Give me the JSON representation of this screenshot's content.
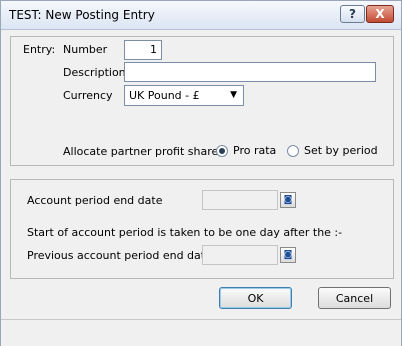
{
  "window": {
    "title": "TEST: New Posting Entry",
    "help_label": "?",
    "close_label": "X"
  },
  "entry": {
    "entry_label": "Entry:",
    "number_label": "Number",
    "number_value": "1",
    "description_label": "Description",
    "description_value": "",
    "currency_label": "Currency",
    "currency_value": "UK Pound - £",
    "allocate_label": "Allocate partner profit shares",
    "allocation_options": [
      {
        "label": "Pro rata",
        "selected": true
      },
      {
        "label": "Set by period",
        "selected": false
      }
    ]
  },
  "period": {
    "end_date_label": "Account period end date",
    "end_date_value": "",
    "start_note": "Start of account period is taken to be one day after the :-",
    "prev_end_label": "Previous account period end date",
    "prev_end_value": ""
  },
  "buttons": {
    "ok": "OK",
    "cancel": "Cancel"
  },
  "icons": {
    "dropdown": "chevron-down-icon",
    "date_picker": "calendar-picker-icon"
  },
  "colors": {
    "title_bar": "#dbe5f3",
    "close_button": "#c34a33",
    "default_button_border": "#3c7fb1"
  }
}
